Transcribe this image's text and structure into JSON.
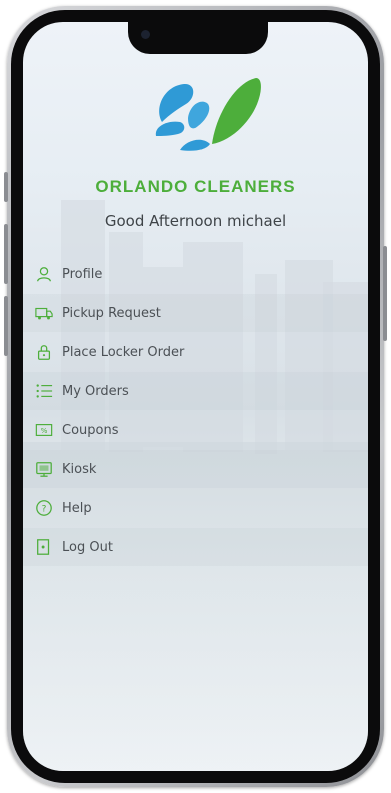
{
  "app": {
    "brand_name": "ORLANDO CLEANERS",
    "greeting": "Good Afternoon michael",
    "brand_color": "#4dae3b",
    "logo_colors": [
      "#2f9ad6",
      "#4dae3b"
    ]
  },
  "menu": {
    "items": [
      {
        "label": "Profile",
        "icon": "user-icon"
      },
      {
        "label": "Pickup Request",
        "icon": "van-icon"
      },
      {
        "label": "Place Locker Order",
        "icon": "lock-icon"
      },
      {
        "label": "My Orders",
        "icon": "list-icon"
      },
      {
        "label": "Coupons",
        "icon": "coupon-icon"
      },
      {
        "label": "Kiosk",
        "icon": "kiosk-icon"
      },
      {
        "label": "Help",
        "icon": "help-icon"
      },
      {
        "label": "Log Out",
        "icon": "logout-icon"
      }
    ]
  }
}
